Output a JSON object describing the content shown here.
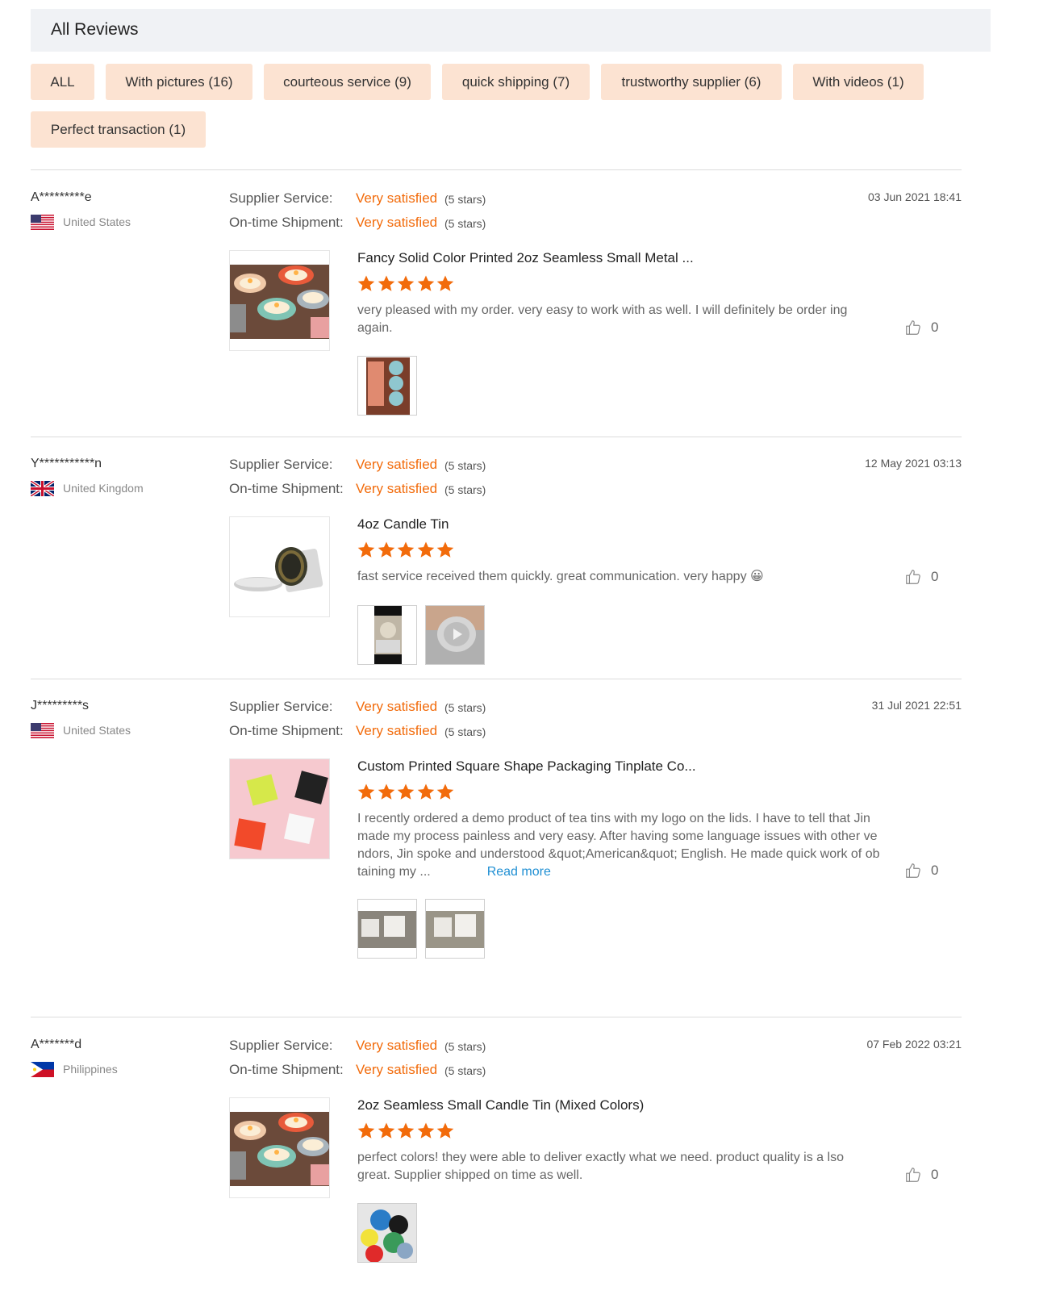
{
  "header": {
    "title": "All Reviews"
  },
  "filters": [
    {
      "label": "ALL"
    },
    {
      "label": "With pictures (16)"
    },
    {
      "label": "courteous service (9)"
    },
    {
      "label": "quick shipping (7)"
    },
    {
      "label": "trustworthy supplier (6)"
    },
    {
      "label": "With videos (1)"
    },
    {
      "label": "Perfect transaction (1)"
    }
  ],
  "labels": {
    "supplier_service": "Supplier Service:",
    "ontime_shipment": "On-time Shipment:",
    "read_more": "Read more"
  },
  "colors": {
    "accent": "#f26b0b",
    "filter_bg": "#fce3d2",
    "link": "#1f8fd3",
    "header_bg": "#f0f2f5"
  },
  "reviews": [
    {
      "reviewer": "A*********e",
      "country": "United States",
      "flag_icon": "us-flag-icon",
      "date": "03 Jun 2021 18:41",
      "supplier_service": "Very satisfied",
      "supplier_service_stars": "(5 stars)",
      "ontime_shipment": "Very satisfied",
      "ontime_shipment_stars": "(5 stars)",
      "product_title": "Fancy Solid Color Printed 2oz Seamless Small Metal ...",
      "rating": 5,
      "text": "very pleased with my order. very easy to work with as well. I will definitely be order ing again.",
      "likes": "0"
    },
    {
      "reviewer": "Y***********n",
      "country": "United Kingdom",
      "flag_icon": "uk-flag-icon",
      "date": "12 May 2021 03:13",
      "supplier_service": "Very satisfied",
      "supplier_service_stars": "(5 stars)",
      "ontime_shipment": "Very satisfied",
      "ontime_shipment_stars": "(5 stars)",
      "product_title": "4oz Candle Tin",
      "rating": 5,
      "text": "fast service received them quickly. great communication. very happy 😀",
      "likes": "0"
    },
    {
      "reviewer": "J*********s",
      "country": "United States",
      "flag_icon": "us-flag-icon",
      "date": "31 Jul 2021 22:51",
      "supplier_service": "Very satisfied",
      "supplier_service_stars": "(5 stars)",
      "ontime_shipment": "Very satisfied",
      "ontime_shipment_stars": "(5 stars)",
      "product_title": "Custom Printed Square Shape Packaging Tinplate Co...",
      "rating": 5,
      "text": "I recently ordered a demo product of tea tins with my logo on the lids. I have to tell that Jin made my process painless and very easy. After having some language issues with other ve ndors, Jin spoke and understood &quot;American&quot; English. He made quick work of ob taining my ...",
      "likes": "0"
    },
    {
      "reviewer": "A*******d",
      "country": "Philippines",
      "flag_icon": "ph-flag-icon",
      "date": "07 Feb 2022 03:21",
      "supplier_service": "Very satisfied",
      "supplier_service_stars": "(5 stars)",
      "ontime_shipment": "Very satisfied",
      "ontime_shipment_stars": "(5 stars)",
      "product_title": "2oz Seamless Small Candle Tin (Mixed Colors)",
      "rating": 5,
      "text": "perfect colors! they were able to deliver exactly what we need. product quality is a lso great. Supplier shipped on time as well.",
      "likes": "0"
    }
  ]
}
